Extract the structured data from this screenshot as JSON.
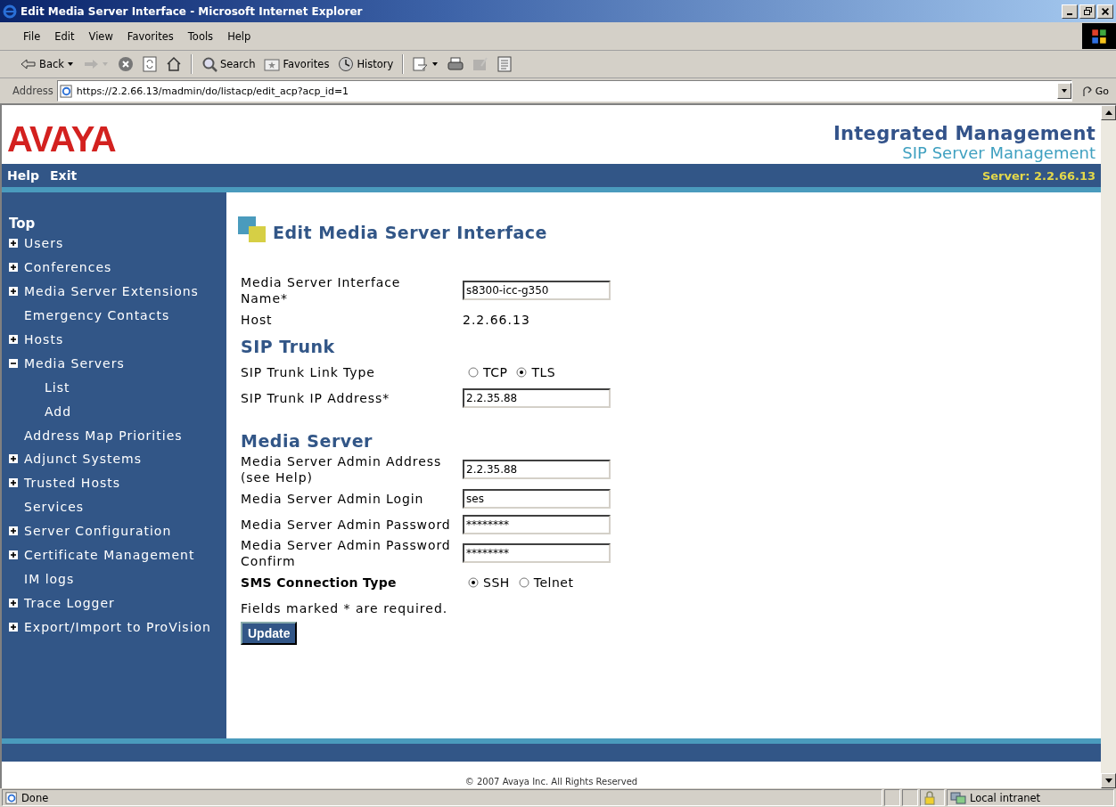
{
  "window": {
    "title": "Edit Media Server Interface - Microsoft Internet Explorer"
  },
  "menu": [
    "File",
    "Edit",
    "View",
    "Favorites",
    "Tools",
    "Help"
  ],
  "toolbar": [
    {
      "kind": "back",
      "label": "Back",
      "disabled": false
    },
    {
      "kind": "forward",
      "disabled": true
    },
    {
      "kind": "stop",
      "disabled": false
    },
    {
      "kind": "refresh",
      "disabled": false
    },
    {
      "kind": "home",
      "disabled": false
    },
    {
      "kind": "search",
      "label": "Search",
      "disabled": false
    },
    {
      "kind": "favorites",
      "label": "Favorites",
      "disabled": false
    },
    {
      "kind": "history",
      "label": "History",
      "disabled": false
    },
    {
      "kind": "mail",
      "disabled": false
    },
    {
      "kind": "print",
      "disabled": false
    },
    {
      "kind": "edit",
      "disabled": true
    },
    {
      "kind": "discuss",
      "disabled": false
    }
  ],
  "address_bar": {
    "label": "Address",
    "url": "https://2.2.66.13/madmin/do/listacp/edit_acp?acp_id=1",
    "go": "Go"
  },
  "header": {
    "logo": "AVAYA",
    "title": "Integrated Management",
    "subtitle": "SIP Server Management",
    "links": [
      "Help",
      "Exit"
    ],
    "server": "Server: 2.2.66.13"
  },
  "sidebar": {
    "heading": "Top",
    "items": [
      {
        "label": "Users",
        "expanded": false
      },
      {
        "label": "Conferences",
        "expanded": false
      },
      {
        "label": "Media Server Extensions",
        "expanded": false
      },
      {
        "label": "Emergency Contacts"
      },
      {
        "label": "Hosts",
        "expanded": false
      },
      {
        "label": "Media Servers",
        "expanded": true,
        "children": [
          {
            "label": "List"
          },
          {
            "label": "Add"
          }
        ]
      },
      {
        "label": "Address Map Priorities"
      },
      {
        "label": "Adjunct Systems",
        "expanded": false
      },
      {
        "label": "Trusted Hosts",
        "expanded": false
      },
      {
        "label": "Services"
      },
      {
        "label": "Server Configuration",
        "expanded": false
      },
      {
        "label": "Certificate Management",
        "expanded": false
      },
      {
        "label": "IM logs"
      },
      {
        "label": "Trace Logger",
        "expanded": false
      },
      {
        "label": "Export/Import to ProVision",
        "expanded": false
      }
    ]
  },
  "form": {
    "title": "Edit Media Server Interface",
    "sections": [
      {
        "rows": [
          {
            "kind": "text_field",
            "label": "Media Server Interface Name*",
            "value": "s8300-icc-g350"
          },
          {
            "kind": "static",
            "label": "Host",
            "value": "2.2.66.13"
          }
        ]
      },
      {
        "heading": "SIP Trunk",
        "rows": [
          {
            "kind": "radio",
            "label": "SIP Trunk Link Type",
            "options": [
              {
                "label": "TCP",
                "selected": false
              },
              {
                "label": "TLS",
                "selected": true
              }
            ]
          },
          {
            "kind": "text_field",
            "label": "SIP Trunk IP Address*",
            "value": "2.2.35.88"
          }
        ]
      },
      {
        "heading": "Media Server",
        "rows": [
          {
            "kind": "text_field",
            "label": "Media Server Admin Address (see Help)",
            "value": "2.2.35.88"
          },
          {
            "kind": "text_field",
            "label": "Media Server Admin Login",
            "value": "ses"
          },
          {
            "kind": "text_field",
            "label": "Media Server Admin Password",
            "value": "********"
          },
          {
            "kind": "text_field",
            "label": "Media Server Admin Password Confirm",
            "value": "********"
          },
          {
            "kind": "radio",
            "label": "SMS Connection Type",
            "bold": true,
            "options": [
              {
                "label": "SSH",
                "selected": true
              },
              {
                "label": "Telnet",
                "selected": false
              }
            ]
          }
        ]
      }
    ],
    "note": "Fields marked * are required.",
    "submit": "Update"
  },
  "footer": {
    "copyright": "© 2007 Avaya Inc. All Rights Reserved"
  },
  "status_bar": {
    "text": "Done",
    "zone": "Local intranet"
  }
}
